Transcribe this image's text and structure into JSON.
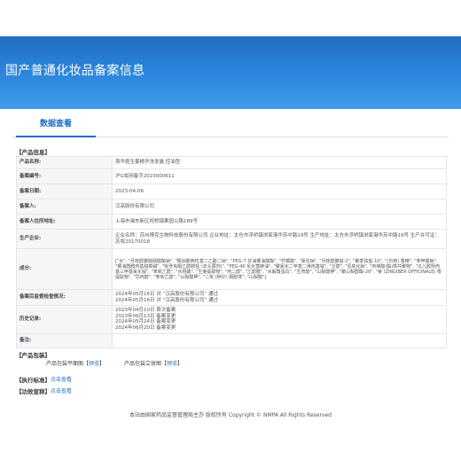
{
  "page": {
    "title": "国产普通化妆品备案信息",
    "tab": "数据查看",
    "product_info_header": "【产品信息】",
    "package_header": "【产品包装】",
    "standard_header": "【执行标准】",
    "report_header": "【功效宣称】",
    "view_text": "点击查看",
    "footer": "本站由国家药品监督管理局主办 版权所有 Copyright © NMPA All Rights Reserved"
  },
  "fields": [
    {
      "label": "产品名称:",
      "value": "燕华霆生姜精华洗发露 控油型"
    },
    {
      "label": "备案编号:",
      "value": "沪G妆网备字2023000611"
    },
    {
      "label": "备案日期:",
      "value": "2023-04-06"
    },
    {
      "label": "备案人:",
      "value": "汉高股份有限公司"
    },
    {
      "label": "备案人住所地址:",
      "value": "上海市浦东新区祝桥镇果园公路189号"
    },
    {
      "label": "生产企业:",
      "value": "企业名称：苏州博克生物科技股份有限公司 企业地址：太仓市浮桥镇浏家港华苏中路19号 生产地址：太仓市浮桥镇浏家港华苏中路19号 生产许可证：苏妆20170018"
    },
    {
      "label": "成分:",
      "value": "[\"水\", \"月桂醇聚醚硫酸酯钠\", \"椰油酰两性基二乙酸二钠\", \"PEG-7 甘油椰油酸酯\", \"柠檬酸\", \"氯化钠\", \"月桂醇聚醚-2\", \"聚季铵盐-10\", \"(日用) 香精\", \"苯甲酸钠\", \"椰油酰胺丙基甜菜碱\", \"吡罗克酮乙醇胺盐 (去头屑剂)\", \"PEG-40 氢化蓖麻油\", \"聚氯化二甲基二烯丙基铵\", \"泛醇\", \"氢氧化钠\", \"丙烯酸(酯)类共聚物\", \"瓜儿胶羟丙基三甲基氯化铵\", \"苯氧乙醇\", \"水杨酸\", \"生姜提取物\", \"丙二醇\", \"乙醇胺\", \"水解角蛋白\", \"生育酚\", \"山梨酸钾\", \"聚山梨醇酯-20\", \"姜 (ZINGIBER OFFICINALE) 根提取物\", \"异丙醇\", \"苯氧乙醇\", \"山梨酸钾\", \"二氧 (种仔) 酮胶体\", \"山梨酸\"]"
    },
    {
      "label": "备案后监督检查情况:",
      "value": "2024年05月16日 对 “汉高股份有限公司” 通过\n2024年05月16日 对 “汉高股份有限公司” 通过"
    },
    {
      "label": "历史记录:",
      "value": "2023年04月10日 首次备案\n2023年09月13日 备案变更\n2024年05月24日 备案变更\n2024年06月20日 备案变更"
    },
    {
      "label": "备注:",
      "value": ""
    }
  ],
  "package": {
    "flat_label": "产品包装平面图",
    "solid_label": "产品包装立体图",
    "preview_text": "预览"
  }
}
